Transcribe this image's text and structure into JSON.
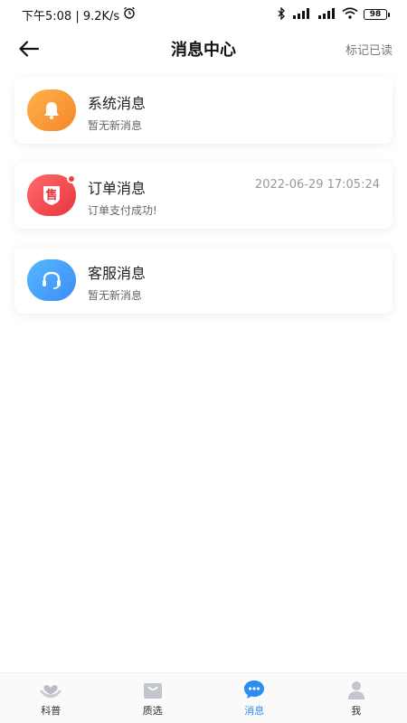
{
  "status_bar": {
    "time_speed": "下午5:08 | 9.2K/s",
    "battery": "98"
  },
  "header": {
    "title": "消息中心",
    "mark_read": "标记已读"
  },
  "messages": [
    {
      "title": "系统消息",
      "subtitle": "暂无新消息",
      "time": "",
      "icon": "bell-icon",
      "unread_badge": false
    },
    {
      "title": "订单消息",
      "subtitle": "订单支付成功!",
      "time": "2022-06-29 17:05:24",
      "icon": "sale-icon",
      "icon_text": "售",
      "unread_badge": true
    },
    {
      "title": "客服消息",
      "subtitle": "暂无新消息",
      "time": "",
      "icon": "headset-icon",
      "unread_badge": false
    }
  ],
  "bottom_nav": {
    "items": [
      {
        "label": "科普",
        "icon": "heart-hands-icon",
        "active": false
      },
      {
        "label": "质选",
        "icon": "shopping-bag-icon",
        "active": false
      },
      {
        "label": "消息",
        "icon": "chat-bubble-icon",
        "active": true
      },
      {
        "label": "我",
        "icon": "person-icon",
        "active": false
      }
    ]
  },
  "colors": {
    "accent": "#2b8cf2",
    "system_icon": "#f5872a",
    "order_icon": "#e8363e",
    "service_icon": "#3c8df5"
  }
}
